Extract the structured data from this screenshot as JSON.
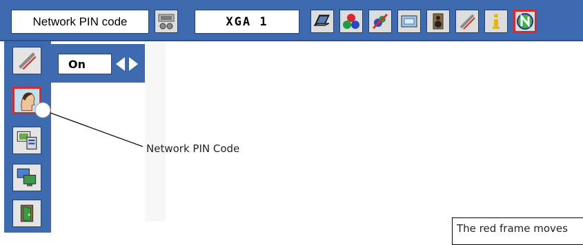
{
  "header": {
    "menu_title": "Network PIN code",
    "resolution": "XGA 1",
    "toolbar_icons": [
      {
        "name": "pc-adjust-icon"
      },
      {
        "name": "laptop-icon"
      },
      {
        "name": "color-balls-icon"
      },
      {
        "name": "image-adjust-icon"
      },
      {
        "name": "screen-icon"
      },
      {
        "name": "speaker-icon"
      },
      {
        "name": "setting-tools-icon"
      },
      {
        "name": "information-icon"
      },
      {
        "name": "network-icon",
        "active": true
      }
    ]
  },
  "sidebar": {
    "items": [
      {
        "name": "setting-tools-icon"
      },
      {
        "name": "person-profile-icon",
        "active": true
      },
      {
        "name": "network-config-icon"
      },
      {
        "name": "monitor-network-icon"
      },
      {
        "name": "exit-door-icon"
      }
    ]
  },
  "setting": {
    "value": "On"
  },
  "annotations": {
    "callout": "Network PIN Code",
    "note": "The red frame moves"
  },
  "colors": {
    "menu_blue": "#3e6ab0",
    "active_red": "#d8292f"
  }
}
